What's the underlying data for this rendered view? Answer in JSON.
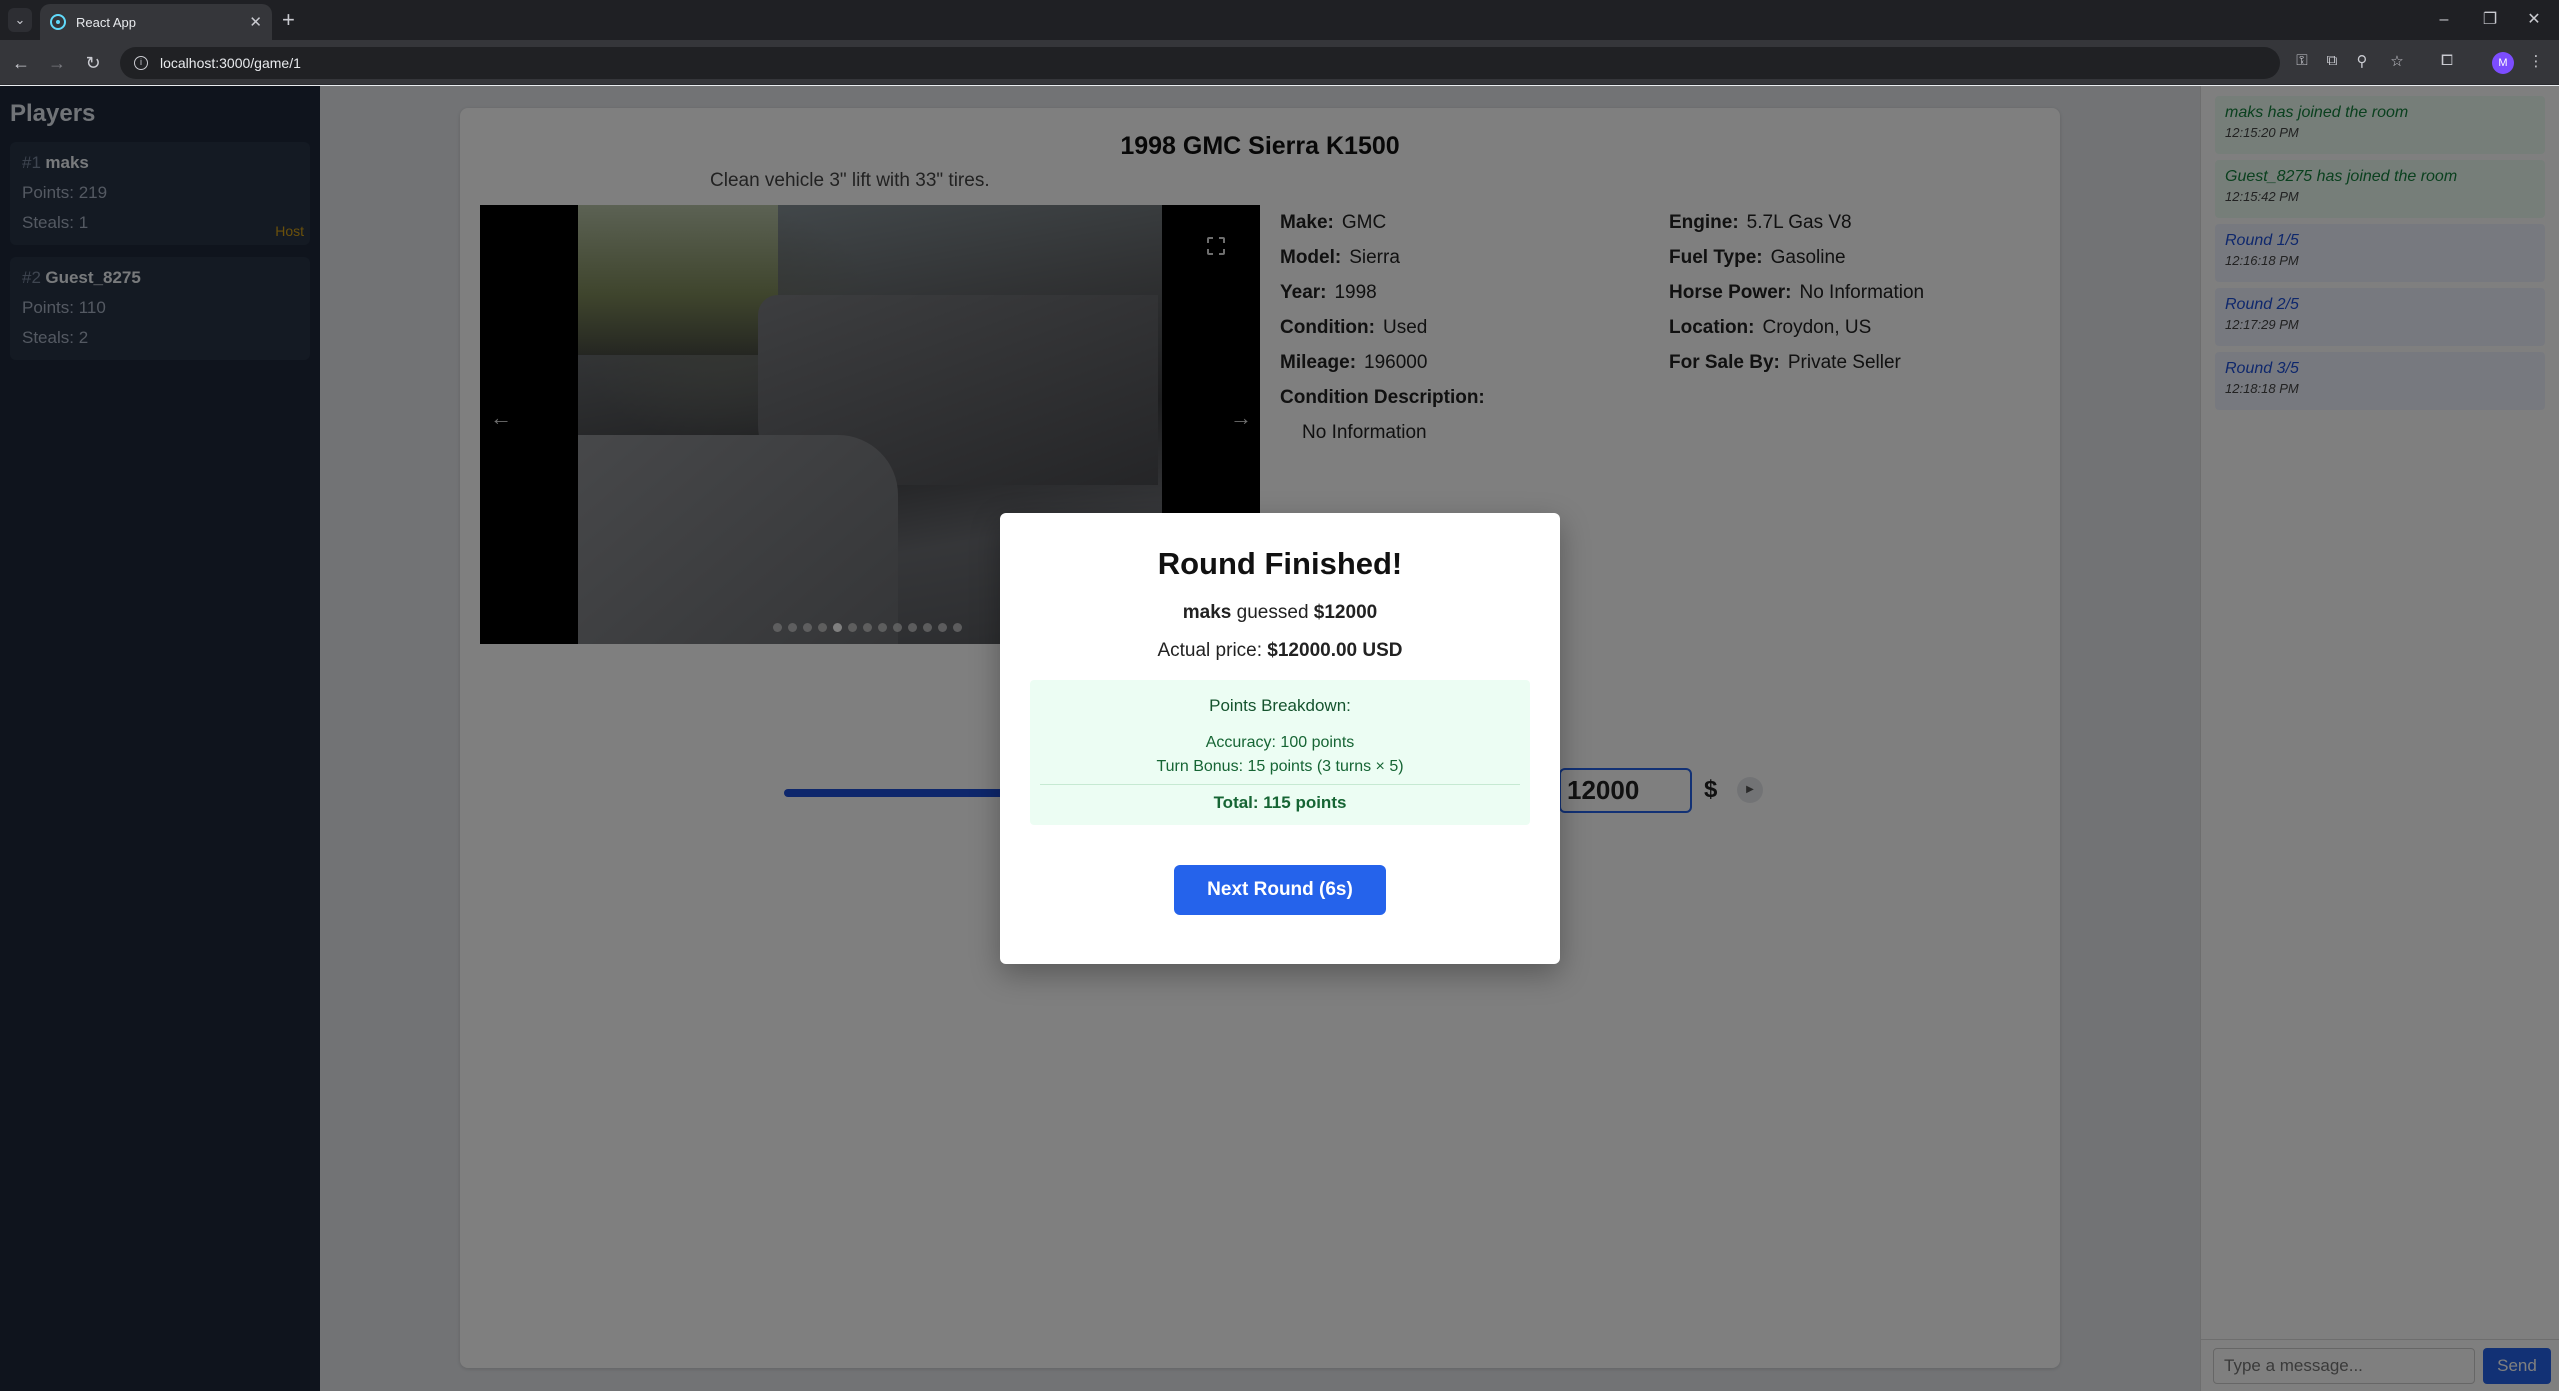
{
  "browser": {
    "tab_title": "React App",
    "url": "localhost:3000/game/1",
    "profile_initial": "M"
  },
  "sidebar": {
    "title": "Players",
    "players": [
      {
        "rank": "#1",
        "name": "maks",
        "points": "Points: 219",
        "steals": "Steals: 1",
        "badge": "Host"
      },
      {
        "rank": "#2",
        "name": "Guest_8275",
        "points": "Points: 110",
        "steals": "Steals: 2"
      }
    ]
  },
  "car": {
    "title": "1998 GMC Sierra K1500",
    "description": "Clean vehicle 3\" lift with 33\" tires.",
    "photo_count": 13,
    "active_photo": 5,
    "specs_left": [
      {
        "key": "Make:",
        "value": "GMC"
      },
      {
        "key": "Model:",
        "value": "Sierra"
      },
      {
        "key": "Year:",
        "value": "1998"
      },
      {
        "key": "Condition:",
        "value": "Used"
      },
      {
        "key": "Mileage:",
        "value": "196000"
      },
      {
        "key": "Condition Description:",
        "value": ""
      },
      {
        "key": "",
        "value": "No Information"
      }
    ],
    "specs_right": [
      {
        "key": "Engine:",
        "value": "5.7L Gas V8"
      },
      {
        "key": "Fuel Type:",
        "value": "Gasoline"
      },
      {
        "key": "Horse Power:",
        "value": "No Information"
      },
      {
        "key": "Location:",
        "value": "Croydon, US"
      },
      {
        "key": "For Sale By:",
        "value": "Private Seller"
      }
    ]
  },
  "guess": {
    "value": "12000",
    "currency": "$"
  },
  "chat": {
    "messages": [
      {
        "text": "maks has joined the room",
        "time": "12:15:20 PM",
        "kind": "join"
      },
      {
        "text": "Guest_8275 has joined the room",
        "time": "12:15:42 PM",
        "kind": "join"
      },
      {
        "text": "Round 1/5",
        "time": "12:16:18 PM",
        "kind": "round"
      },
      {
        "text": "Round 2/5",
        "time": "12:17:29 PM",
        "kind": "round"
      },
      {
        "text": "Round 3/5",
        "time": "12:18:18 PM",
        "kind": "round"
      }
    ],
    "placeholder": "Type a message...",
    "send_label": "Send"
  },
  "modal": {
    "title": "Round Finished!",
    "guesser": "maks",
    "guess_text": "guessed",
    "guess_amount": "$12000",
    "actual_label": "Actual price:",
    "actual_value": "$12000.00 USD",
    "breakdown_title": "Points Breakdown:",
    "accuracy": "Accuracy: 100 points",
    "turn_bonus": "Turn Bonus: 15 points (3 turns × 5)",
    "total": "Total: 115 points",
    "next_button": "Next Round (6s)"
  }
}
